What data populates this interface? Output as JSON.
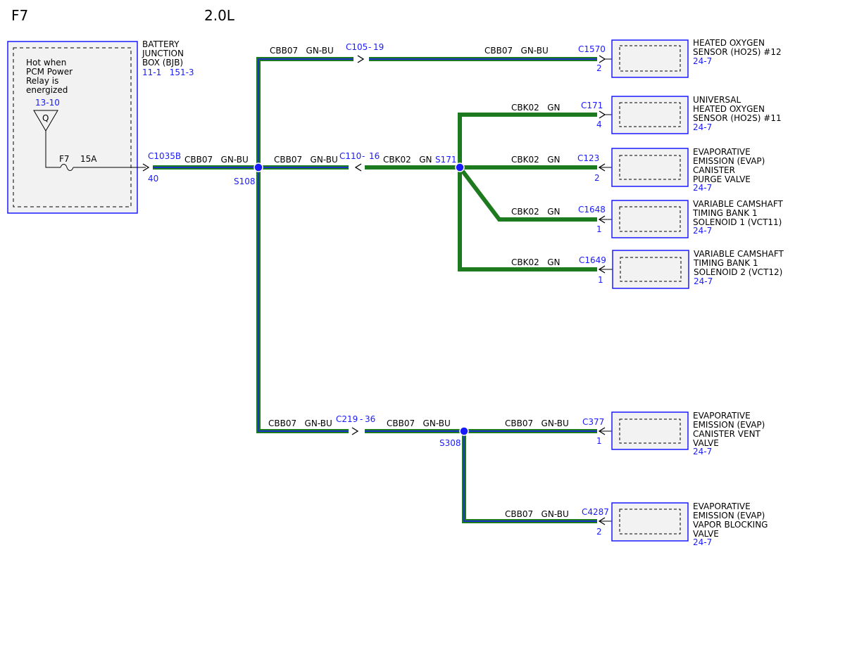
{
  "header": {
    "circuit": "F7",
    "engine": "2.0L"
  },
  "colors": {
    "wire_outer": "#1e7a1e",
    "wire_inner": "#1a1aff",
    "wire_plain": "#1e7a1e",
    "accent": "#1a1aff",
    "box_fill": "#f2f2f2"
  },
  "bjb": {
    "name_lines": [
      "BATTERY",
      "JUNCTION",
      "BOX (BJB)"
    ],
    "ref": "11-1   151-3",
    "note_lines": [
      "Hot when",
      "PCM Power",
      "Relay is",
      "energized"
    ],
    "note_ref": "13-10",
    "relay_label": "Q",
    "fuse_id": "F7",
    "fuse_rating": "15A",
    "connector": "C1035B",
    "pin": "40"
  },
  "splices": {
    "s108": "S108",
    "s171": "S171",
    "s308": "S308"
  },
  "inline_connectors": {
    "c105": "C105",
    "c105_pin": "19",
    "c110": "C110",
    "c110_pin": "16",
    "c219": "C219",
    "c219_pin": "36"
  },
  "wire_labels": {
    "bjb_to_s108": "CBB07   GN-BU",
    "top_trunk": "CBB07   GN-BU",
    "top_to_c1570": "CBB07   GN-BU",
    "s108_to_c110": "CBB07   GN-BU",
    "c110_to_s171": "CBK02   GN",
    "to_c171": "CBK02   GN",
    "to_c123": "CBK02   GN",
    "to_c1648": "CBK02   GN",
    "to_c1649": "CBK02   GN",
    "bottom_trunk": "CBB07   GN-BU",
    "c219_to_s308": "CBB07   GN-BU",
    "to_c377": "CBB07   GN-BU",
    "to_c4287": "CBB07   GN-BU"
  },
  "components": [
    {
      "connector": "C1570",
      "pin": "2",
      "name_lines": [
        "HEATED OXYGEN",
        "SENSOR (HO2S) #12"
      ],
      "ref": "24-7"
    },
    {
      "connector": "C171",
      "pin": "4",
      "name_lines": [
        "UNIVERSAL",
        "HEATED OXYGEN",
        "SENSOR (HO2S) #11"
      ],
      "ref": "24-7"
    },
    {
      "connector": "C123",
      "pin": "2",
      "name_lines": [
        "EVAPORATIVE",
        "EMISSION (EVAP)",
        "CANISTER",
        "PURGE VALVE"
      ],
      "ref": "24-7"
    },
    {
      "connector": "C1648",
      "pin": "1",
      "name_lines": [
        "VARIABLE CAMSHAFT",
        "TIMING BANK 1",
        "SOLENOID 1 (VCT11)"
      ],
      "ref": "24-7"
    },
    {
      "connector": "C1649",
      "pin": "1",
      "name_lines": [
        "VARIABLE CAMSHAFT",
        "TIMING BANK 1",
        "SOLENOID 2 (VCT12)"
      ],
      "ref": "24-7"
    },
    {
      "connector": "C377",
      "pin": "1",
      "name_lines": [
        "EVAPORATIVE",
        "EMISSION (EVAP)",
        "CANISTER VENT",
        "VALVE"
      ],
      "ref": "24-7"
    },
    {
      "connector": "C4287",
      "pin": "2",
      "name_lines": [
        "EVAPORATIVE",
        "EMISSION (EVAP)",
        "VAPOR BLOCKING",
        "VALVE"
      ],
      "ref": "24-7"
    }
  ]
}
